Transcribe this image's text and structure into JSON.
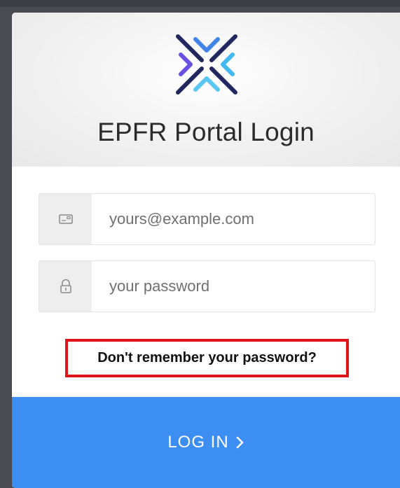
{
  "header": {
    "logo_icon": "epfr-x-logo",
    "title": "EPFR Portal Login"
  },
  "form": {
    "email": {
      "icon": "email-card-icon",
      "placeholder": "yours@example.com",
      "value": ""
    },
    "password": {
      "icon": "lock-icon",
      "placeholder": "your password",
      "value": ""
    },
    "forgot_password_link": "Don't remember your password?",
    "highlight_color": "#e0141c"
  },
  "submit": {
    "label": "LOG IN",
    "icon": "chevron-right-icon",
    "color": "#3c8ef3"
  }
}
